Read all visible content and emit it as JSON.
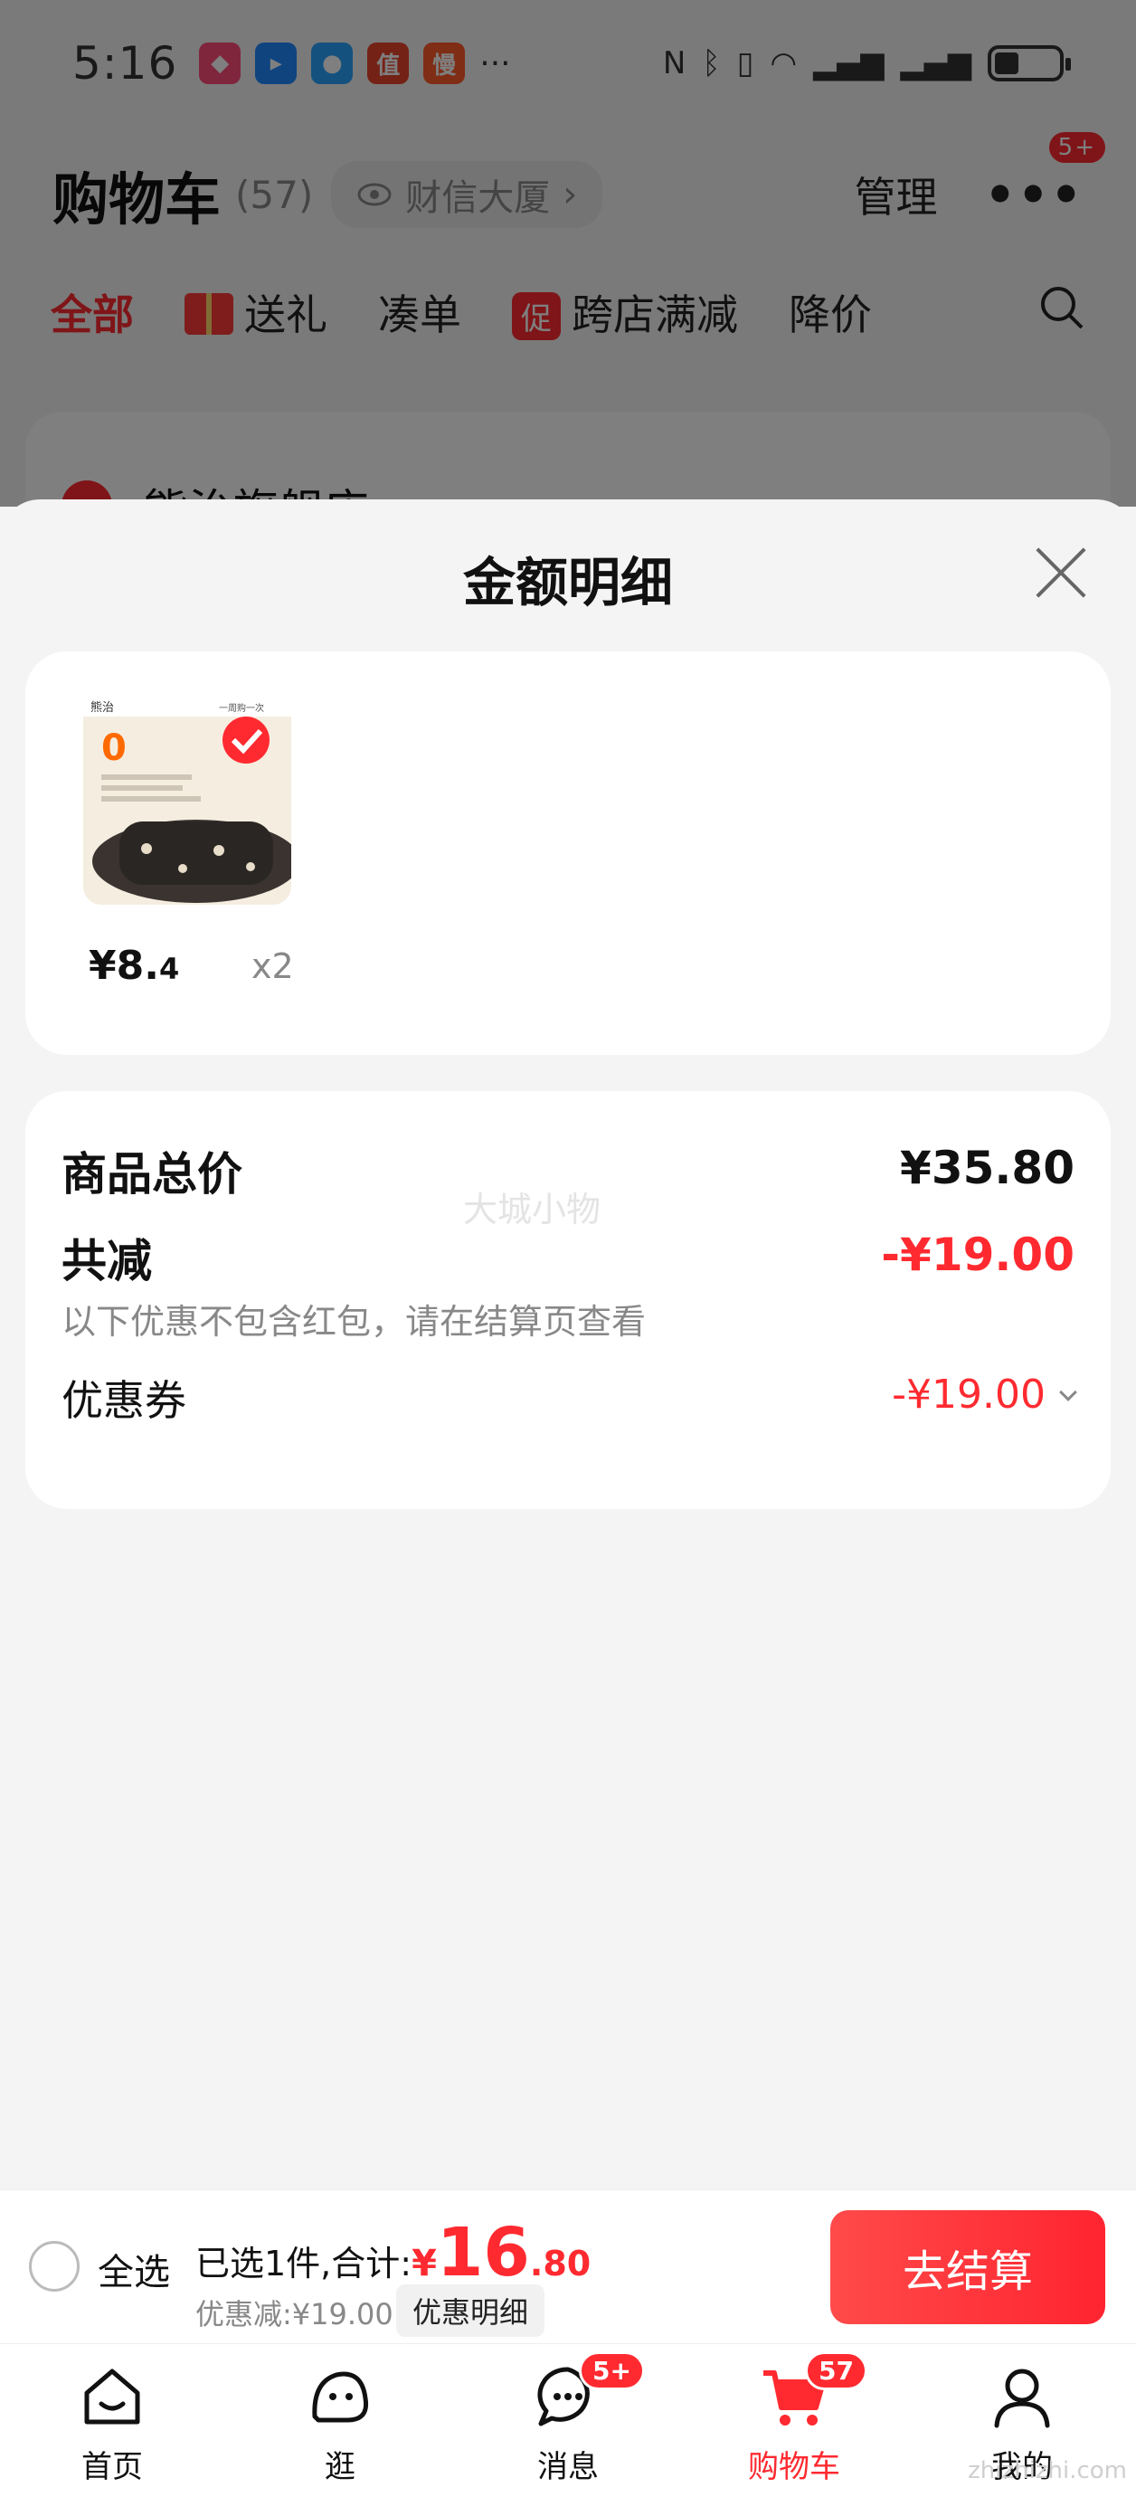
{
  "status_bar": {
    "time": "5:16",
    "more": "···"
  },
  "header": {
    "title": "购物车",
    "count": "(57)",
    "address": "财信大厦",
    "manage": "管理",
    "more_badge": "5+"
  },
  "filters": [
    "全部",
    "送礼",
    "凑单",
    "跨店满减",
    "降价"
  ],
  "filter_tag_icon": "促",
  "store": {
    "name": "熊治旗舰店"
  },
  "sheet": {
    "title": "金额明细",
    "item": {
      "price_int": "¥8.",
      "price_dec": "4",
      "qty": "x2"
    },
    "watermark": "大城小物",
    "total_label": "商品总价",
    "total_value": "¥35.80",
    "reduce_label": "共减",
    "reduce_value": "-¥19.00",
    "reduce_note": "以下优惠不包含红包，请在结算页查看",
    "coupon_label": "优惠券",
    "coupon_value": "-¥19.00"
  },
  "checkout": {
    "select_all": "全选",
    "summary_prefix": "已选1件,合计:",
    "currency": "¥",
    "amount_int": "16",
    "amount_dec": ".80",
    "saving": "优惠减:¥19.00",
    "detail_button": "优惠明细",
    "pay_button": "去结算"
  },
  "tabbar": [
    {
      "label": "首页",
      "icon": "home-icon"
    },
    {
      "label": "逛",
      "icon": "browse-icon"
    },
    {
      "label": "消息",
      "icon": "message-icon",
      "badge": "5+"
    },
    {
      "label": "购物车",
      "icon": "cart-icon",
      "badge": "57",
      "active": true
    },
    {
      "label": "我的",
      "icon": "profile-icon"
    }
  ],
  "corner_mark": "zhizhizhi.com",
  "colors": {
    "accent": "#ff2a30",
    "background": "#f4f4f4"
  }
}
